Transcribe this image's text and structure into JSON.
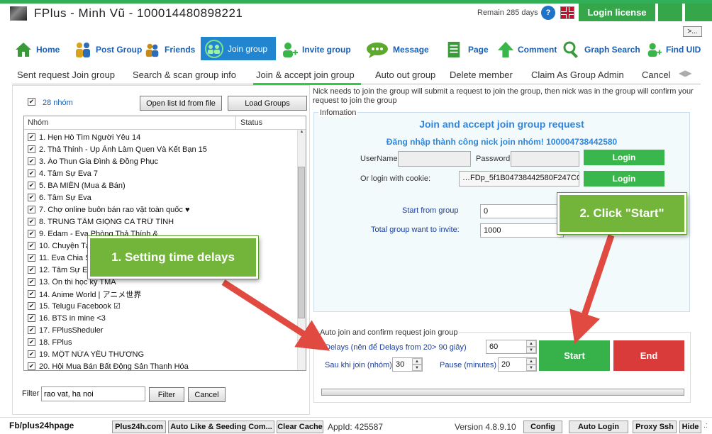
{
  "titlebar": {
    "title": "FPlus - Minh Vũ - 100014480898221",
    "remain": "Remain 285 days",
    "help_glyph": "?",
    "login_license": "Login license",
    "more_label": ">..."
  },
  "nav": [
    {
      "label": "Home",
      "icon": "home-icon",
      "color": "#3a9a3a"
    },
    {
      "label": "Post Group",
      "icon": "people-icon",
      "color": "#2b6db8"
    },
    {
      "label": "Friends",
      "icon": "friends-icon",
      "color": "#c58a1a"
    },
    {
      "label": "Join group",
      "icon": "join-group-icon",
      "color": "#3ab54a"
    },
    {
      "label": "Invite group",
      "icon": "invite-icon",
      "color": "#3ab54a"
    },
    {
      "label": "Message",
      "icon": "message-icon",
      "color": "#5da92e"
    },
    {
      "label": "Page",
      "icon": "page-icon",
      "color": "#3a9a3a"
    },
    {
      "label": "Comment",
      "icon": "comment-icon",
      "color": "#3ab54a"
    },
    {
      "label": "Graph Search",
      "icon": "search-icon",
      "color": "#3a9a3a"
    },
    {
      "label": "Find UID",
      "icon": "find-uid-icon",
      "color": "#3ab54a"
    }
  ],
  "subtabs": [
    "Sent request Join group",
    "Search & scan group info",
    "Join & accept join group",
    "Auto out group",
    "Delete member",
    "Claim As Group Admin",
    "Cancel"
  ],
  "left": {
    "count_label": "28 nhóm",
    "open_list_btn": "Open list Id from file",
    "load_groups_btn": "Load Groups",
    "col_group": "Nhóm",
    "col_status": "Status",
    "groups": [
      "1. Hẹn Hò Tìm Người Yêu 14",
      "2. Thả Thính - Up Ảnh Làm Quen Và Kết Bạn 15",
      "3. Áo Thun Gia Đình & Đồng Phục",
      "4. Tâm Sự Eva 7",
      "5. BA MIỀN (Mua & Bán)",
      "6. Tâm Sự Eva",
      "7. Chợ online buôn bán rao vặt toàn quốc ♥",
      "8. TRUNG TÂM GIỌNG CA TRỮ TÌNH",
      "9. Edam - Eva Phòng Thả Thính &",
      "10. Chuyện Tám",
      "11. Eva Chia Sẻ",
      "12. Tâm Sự EVA",
      "13. Ôn thi học kỳ TMA",
      "14. Anime World | アニメ世界",
      "15. Telugu Facebook ☑",
      "16. BTS in mine <3",
      "17. FPlusSheduler",
      "18. FPlus",
      "19. MỘT NỬA YÊU THƯƠNG",
      "20. Hội Mua Bán Bất Động Sản Thanh Hóa"
    ],
    "filter_label": "Filter",
    "filter_value": "rao vat, ha noi",
    "filter_btn": "Filter",
    "cancel_btn": "Cancel"
  },
  "right": {
    "description": "Nick needs to join the group will submit a request to join the group, then nick was in the group will confirm your request to join the group",
    "info_legend": "Infomation",
    "heading": "Join and accept join group request",
    "login_status": "Đăng nhập thành công nick join nhóm! 100004738442580",
    "username_label": "UserName",
    "password_label": "Password",
    "login_btn": "Login",
    "cookie_label": "Or login with cookie:",
    "cookie_value": "…FDp_5f1B04738442580F247CC;",
    "start_from_label": "Start from group",
    "start_from_value": "0",
    "total_label": "Total group want to invite:",
    "total_value": "1000",
    "auto_legend": "Auto join and confirm request join group",
    "delays_label": "Delays (nên để Delays from 20> 90 giây)",
    "delays_value": "60",
    "after_join_label": "Sau khi join (nhóm)",
    "after_join_value": "30",
    "pause_label": "Pause (minutes)",
    "pause_value": "20",
    "start_btn": "Start",
    "end_btn": "End"
  },
  "callouts": {
    "one": "1. Setting time delays",
    "two": "2. Click \"Start\""
  },
  "status": {
    "fb": "Fb/plus24hpage",
    "site": "Plus24h.com",
    "auto_like": "Auto Like & Seeding Com...",
    "clear_cache": "Clear Cache",
    "appid": "AppId: 425587",
    "version": "Version 4.8.9.10",
    "config": "Config",
    "auto_login": "Auto Login",
    "proxy": "Proxy Ssh",
    "hide": "Hide",
    "grip": ".:"
  },
  "colors": {
    "accent": "#31b057",
    "nav_active": "#2186cf",
    "start": "#37b14a",
    "end": "#d93a3a",
    "heading": "#2e86de",
    "callout": "#73b43b",
    "arrow": "#e04a40"
  }
}
